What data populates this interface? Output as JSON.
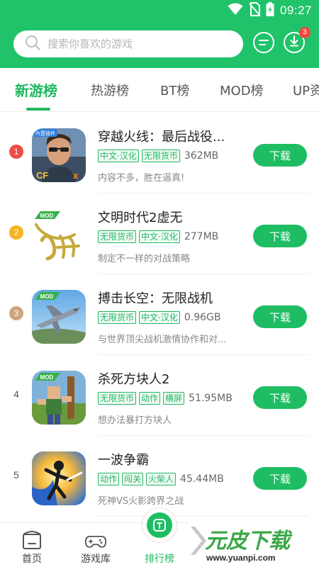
{
  "status": {
    "time": "09:27"
  },
  "search": {
    "placeholder": "搜索你喜欢的游戏"
  },
  "header": {
    "download_badge": "3"
  },
  "tabs": [
    {
      "label": "新游榜",
      "active": true
    },
    {
      "label": "热游榜"
    },
    {
      "label": "BT榜"
    },
    {
      "label": "MOD榜"
    },
    {
      "label": "UP资"
    }
  ],
  "games": [
    {
      "rank": "1",
      "name": "穿越火线：最后战役...",
      "tags": [
        "中文·汉化",
        "无限货币"
      ],
      "size": "362MB",
      "desc": "内容不多，胜在逼真!",
      "button": "下载",
      "icon": "cf-soldier-icon"
    },
    {
      "rank": "2",
      "name": "文明时代2虚无",
      "tags": [
        "无限货币",
        "中文·汉化"
      ],
      "size": "277MB",
      "desc": "制定不一样的对战策略",
      "button": "下载",
      "icon": "calligraphy-mod-icon"
    },
    {
      "rank": "3",
      "name": "搏击长空：无限战机",
      "tags": [
        "无限货币",
        "中文·汉化"
      ],
      "size": "0.96GB",
      "desc": "与世界顶尖战机激情协作和对...",
      "button": "下载",
      "icon": "fighter-jet-icon"
    },
    {
      "rank": "4",
      "name": "杀死方块人2",
      "tags": [
        "无限货币",
        "动作",
        "横屏"
      ],
      "size": "51.95MB",
      "desc": "想办法暴打方块人",
      "button": "下载",
      "icon": "blocky-man-icon"
    },
    {
      "rank": "5",
      "name": "一波争霸",
      "tags": [
        "动作",
        "闯关",
        "火柴人"
      ],
      "size": "45.44MB",
      "desc": "死神VS火影跨界之战",
      "button": "下载",
      "icon": "stickman-fight-icon"
    }
  ],
  "rank_colors": {
    "1": "#ef4b45",
    "2": "#f7b321",
    "3": "#cfa57f"
  },
  "icon_labels": {
    "mod": "MOD",
    "plugin": "内置插件"
  },
  "nav": [
    {
      "label": "首页"
    },
    {
      "label": "游戏库"
    },
    {
      "label": "排行榜",
      "active": true
    }
  ],
  "watermark": {
    "brand": "元皮下载",
    "url": "www.yuanpi.com"
  }
}
